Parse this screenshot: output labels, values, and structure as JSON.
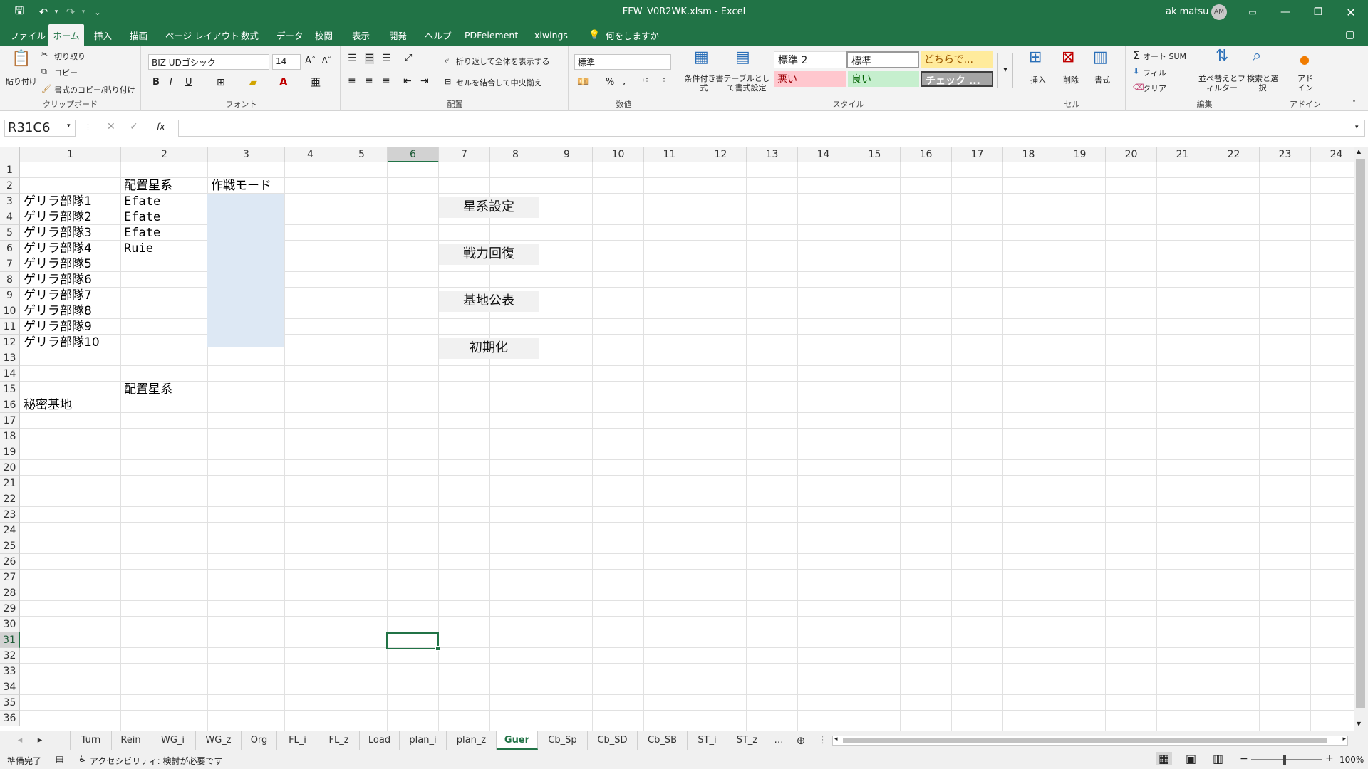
{
  "window": {
    "title": "FFW_V0R2WK.xlsm  -  Excel",
    "user_name": "ak matsu",
    "user_initials": "AM"
  },
  "ribbon_tabs": [
    "ファイル",
    "ホーム",
    "挿入",
    "描画",
    "ページ レイアウト",
    "数式",
    "データ",
    "校閲",
    "表示",
    "開発",
    "ヘルプ",
    "PDFelement",
    "xlwings",
    "何をしますか"
  ],
  "clipboard": {
    "paste": "貼り付け",
    "cut": "切り取り",
    "copy": "コピー",
    "format_painter": "書式のコピー/貼り付け",
    "label": "クリップボード"
  },
  "font": {
    "name": "BIZ UDゴシック",
    "size": "14",
    "bold": "B",
    "italic": "I",
    "underline": "U",
    "label": "フォント"
  },
  "alignment": {
    "wrap": "折り返して全体を表示する",
    "merge": "セルを結合して中央揃え",
    "label": "配置"
  },
  "number": {
    "format": "標準",
    "percent": "%",
    "comma": ",",
    "label": "数値"
  },
  "styles": {
    "cond": "条件付き書式",
    "table": "テーブルとして書式設定",
    "s1": "標準 2",
    "s2": "標準",
    "s3": "どちらで...",
    "s4": "悪い",
    "s5": "良い",
    "s6": "チェック ...",
    "label": "スタイル"
  },
  "cells_group": {
    "insert": "挿入",
    "delete": "削除",
    "format": "書式",
    "label": "セル"
  },
  "editing": {
    "autosum": "オート SUM",
    "fill": "フィル",
    "clear": "クリア",
    "sort": "並べ替えとフィルター",
    "find": "検索と選択",
    "label": "編集"
  },
  "addins": {
    "addin": "アドイン",
    "label": "アドイン"
  },
  "formula_bar": {
    "name_box": "R31C6",
    "fx": "fx",
    "content": ""
  },
  "columns": [
    "1",
    "2",
    "3",
    "4",
    "5",
    "6",
    "7",
    "8",
    "9",
    "10",
    "11",
    "12",
    "13",
    "14",
    "15",
    "16",
    "17",
    "18",
    "19",
    "20",
    "21",
    "22",
    "23",
    "24"
  ],
  "rows": [
    "1",
    "2",
    "3",
    "4",
    "5",
    "6",
    "7",
    "8",
    "9",
    "10",
    "11",
    "12",
    "13",
    "14",
    "15",
    "16",
    "17",
    "18",
    "19",
    "20",
    "21",
    "22",
    "23",
    "24",
    "25",
    "26",
    "27",
    "28",
    "29",
    "30",
    "31",
    "32",
    "33",
    "34",
    "35",
    "36"
  ],
  "cells": {
    "r2c2": "配置星系",
    "r2c3": "作戦モード",
    "r3c1": "ゲリラ部隊1",
    "r4c1": "ゲリラ部隊2",
    "r5c1": "ゲリラ部隊3",
    "r6c1": "ゲリラ部隊4",
    "r7c1": "ゲリラ部隊5",
    "r8c1": "ゲリラ部隊6",
    "r9c1": "ゲリラ部隊7",
    "r10c1": "ゲリラ部隊8",
    "r11c1": "ゲリラ部隊9",
    "r12c1": "ゲリラ部隊10",
    "r3c2": "Efate",
    "r4c2": "Efate",
    "r5c2": "Efate",
    "r6c2": "Ruie",
    "r15c2": "配置星系",
    "r16c1": "秘密基地"
  },
  "buttons": {
    "star_setting": "星系設定",
    "recover": "戦力回復",
    "base_announce": "基地公表",
    "initialize": "初期化"
  },
  "sheet_tabs": [
    "Turn",
    "Rein",
    "WG_i",
    "WG_z",
    "Org",
    "FL_i",
    "FL_z",
    "Load",
    "plan_i",
    "plan_z",
    "Guer",
    "Cb_Sp",
    "Cb_SD",
    "Cb_SB",
    "ST_i",
    "ST_z"
  ],
  "active_sheet": "Guer",
  "status": {
    "ready": "準備完了",
    "accessibility": "アクセシビリティ: 検討が必要です",
    "zoom": "100%"
  },
  "colors": {
    "excel_green": "#217346",
    "selection": "#dde8f4"
  }
}
